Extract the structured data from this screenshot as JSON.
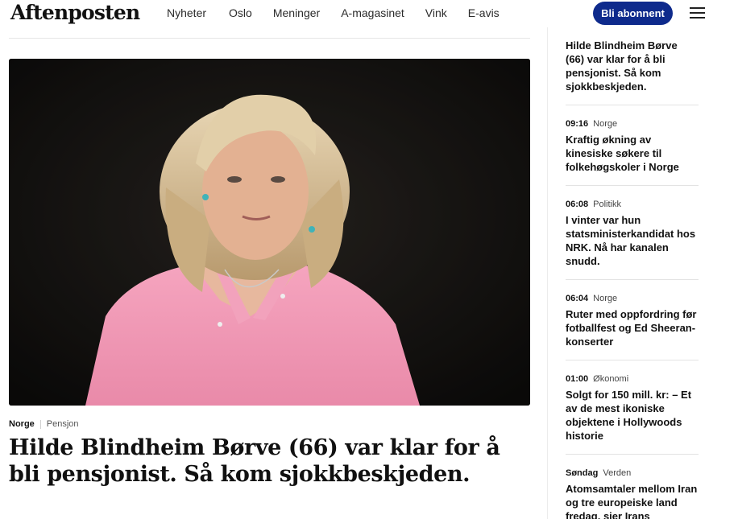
{
  "header": {
    "logo": "Aftenposten",
    "nav": [
      "Nyheter",
      "Oslo",
      "Meninger",
      "A-magasinet",
      "Vink",
      "E-avis"
    ],
    "subscribe_label": "Bli abonnent"
  },
  "main": {
    "section": "Norge",
    "subsection": "Pensjon",
    "headline": "Hilde Blindheim Børve (66) var klar for å bli pensjonist. Så kom sjokkbeskjeden."
  },
  "sidebar": {
    "first_title": "Hilde Blindheim Børve (66) var klar for å bli pensjonist. Så kom sjokkbeskjeden.",
    "items": [
      {
        "time": "09:16",
        "category": "Norge",
        "title": "Kraftig økning av kinesiske søkere til folkehøgskoler i Norge"
      },
      {
        "time": "06:08",
        "category": "Politikk",
        "title": "I vinter var hun statsministerkandidat hos NRK. Nå har kanalen snudd."
      },
      {
        "time": "06:04",
        "category": "Norge",
        "title": "Ruter med oppfordring før fotballfest og Ed Sheeran-konserter"
      },
      {
        "time": "01:00",
        "category": "Økonomi",
        "title": "Solgt for 150 mill. kr: – Et av de mest ikoniske objektene i Hollywoods historie"
      },
      {
        "time": "Søndag",
        "category": "Verden",
        "title": "Atomsamtaler mellom Iran og tre europeiske land fredag, sier Irans"
      }
    ]
  },
  "colors": {
    "brand_blue": "#0e2a8c",
    "text": "#111111",
    "shirt_pink": "#f29ab6"
  }
}
